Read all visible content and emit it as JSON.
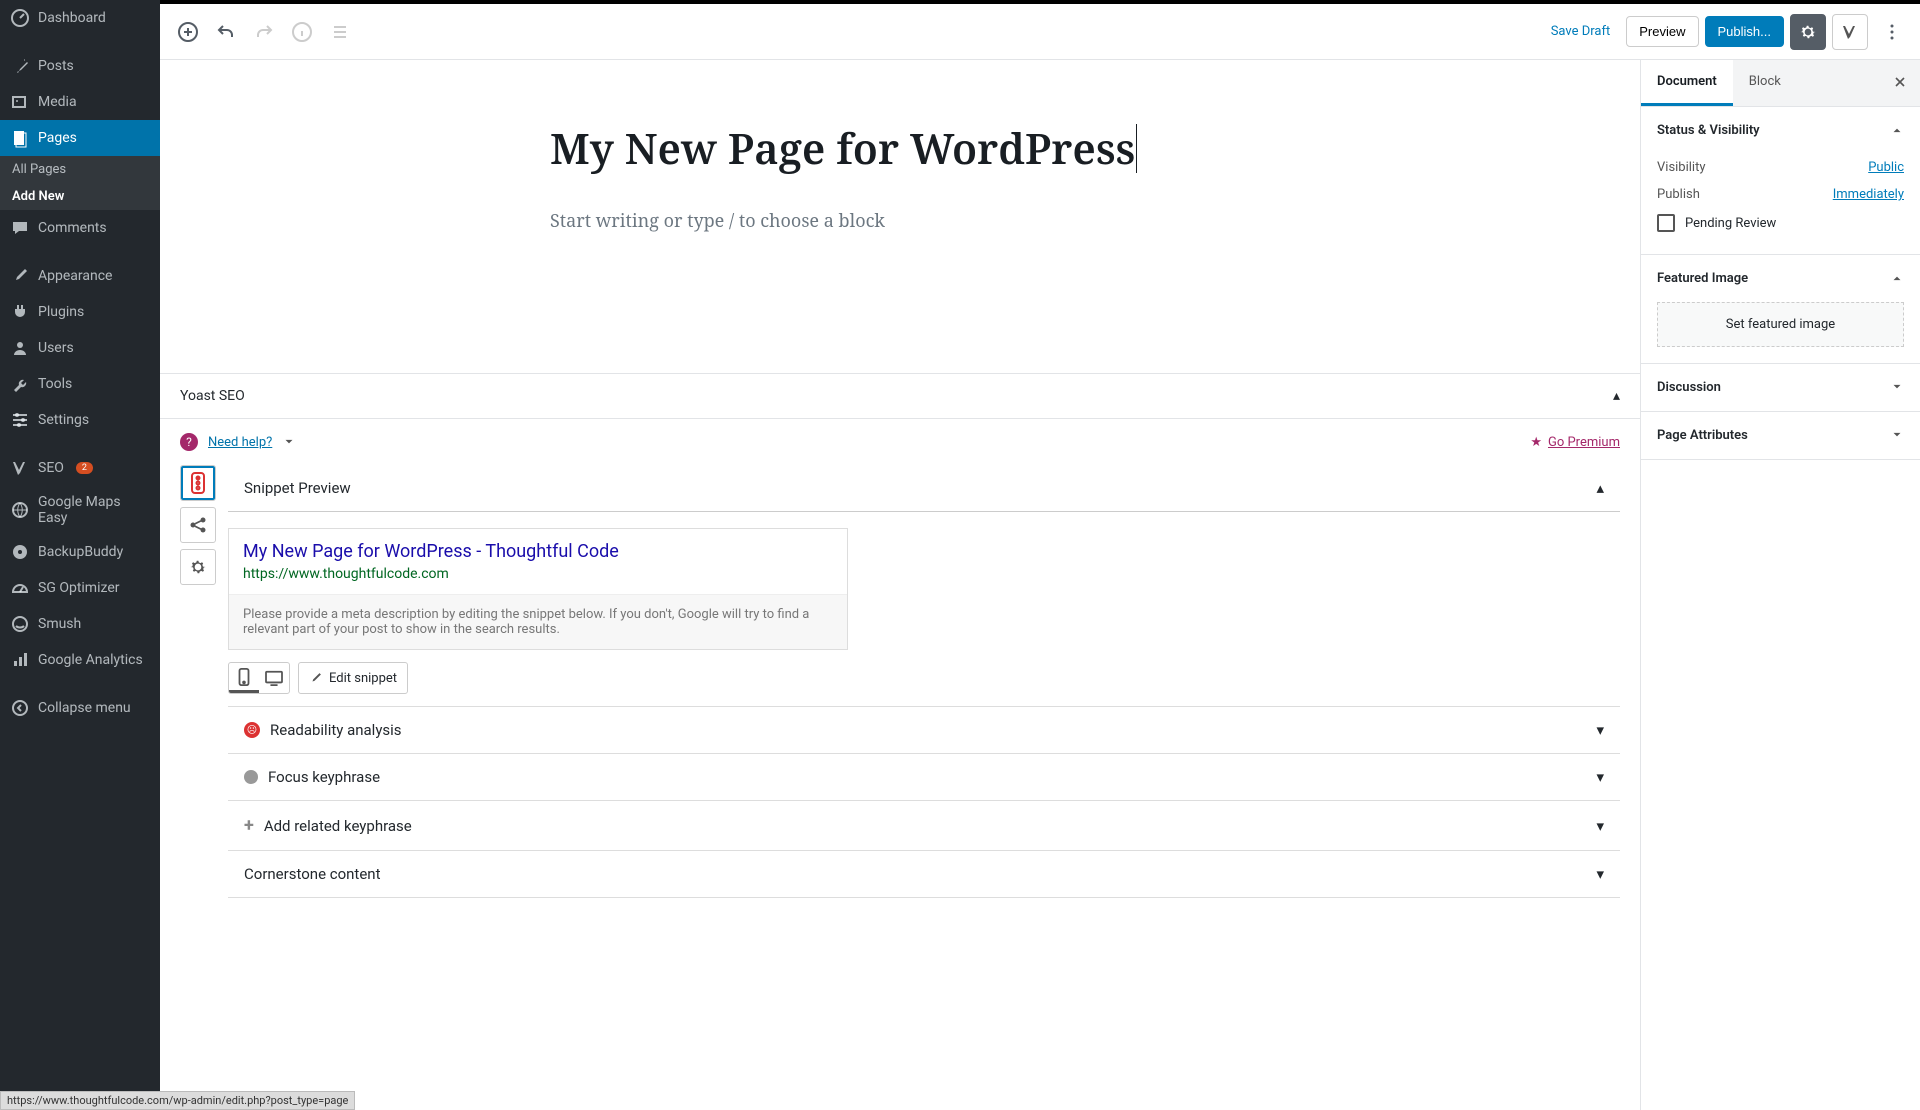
{
  "adminMenu": {
    "dashboard": "Dashboard",
    "posts": "Posts",
    "media": "Media",
    "pages": "Pages",
    "pagesSub": {
      "all": "All Pages",
      "add": "Add New"
    },
    "comments": "Comments",
    "appearance": "Appearance",
    "plugins": "Plugins",
    "users": "Users",
    "tools": "Tools",
    "settings": "Settings",
    "seo": "SEO",
    "seoBadge": "2",
    "gmaps": "Google Maps Easy",
    "backupbuddy": "BackupBuddy",
    "sg": "SG Optimizer",
    "smush": "Smush",
    "ga": "Google Analytics",
    "collapse": "Collapse menu"
  },
  "toolbar": {
    "saveDraft": "Save Draft",
    "preview": "Preview",
    "publish": "Publish..."
  },
  "editor": {
    "title": "My New Page for WordPress",
    "placeholder": "Start writing or type / to choose a block"
  },
  "yoast": {
    "header": "Yoast SEO",
    "needHelp": "Need help?",
    "goPremium": "Go Premium",
    "snippetPreview": "Snippet Preview",
    "snippet": {
      "title": "My New Page for WordPress - Thoughtful Code",
      "url": "https://www.thoughtfulcode.com",
      "desc": "Please provide a meta description by editing the snippet below. If you don't, Google will try to find a relevant part of your post to show in the search results."
    },
    "editSnippet": "Edit snippet",
    "readability": "Readability analysis",
    "focusKeyphrase": "Focus keyphrase",
    "addRelated": "Add related keyphrase",
    "cornerstone": "Cornerstone content"
  },
  "docSidebar": {
    "tabs": {
      "document": "Document",
      "block": "Block"
    },
    "statusVisibility": "Status & Visibility",
    "visibility": "Visibility",
    "visibilityVal": "Public",
    "publish": "Publish",
    "publishVal": "Immediately",
    "pending": "Pending Review",
    "featuredImage": "Featured Image",
    "setFeatured": "Set featured image",
    "discussion": "Discussion",
    "pageAttributes": "Page Attributes"
  },
  "statusBar": "https://www.thoughtfulcode.com/wp-admin/edit.php?post_type=page"
}
